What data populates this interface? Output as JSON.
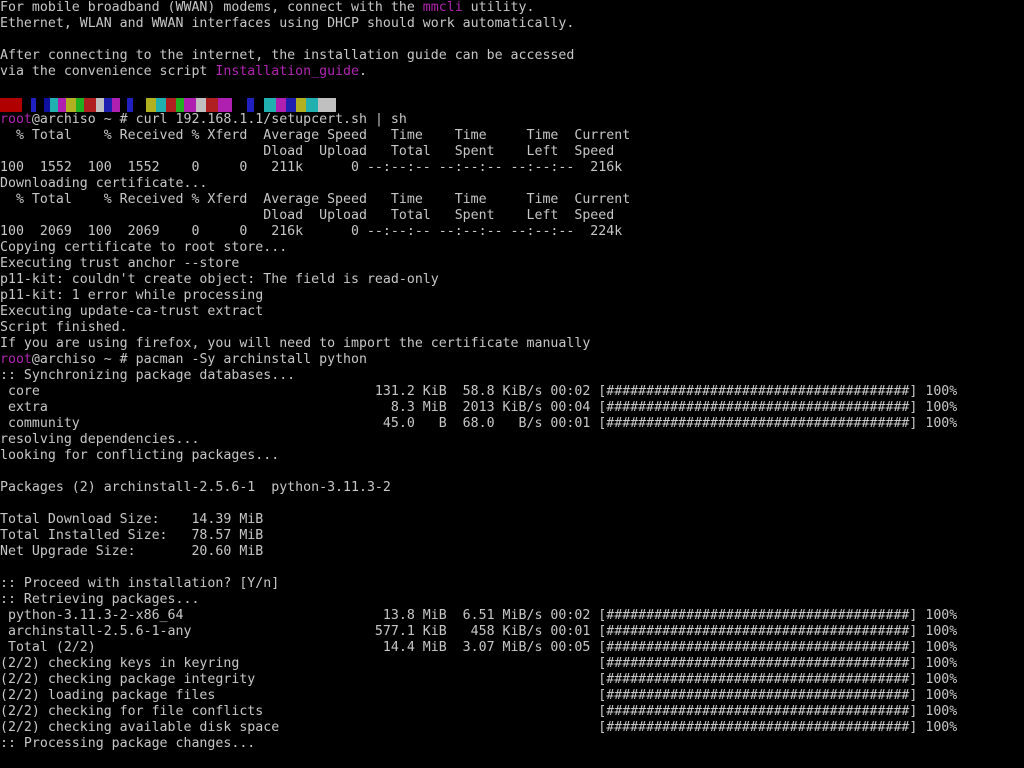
{
  "terminal": {
    "colors": {
      "background": "#000000",
      "text": "#c7c7c7",
      "accent": "#b026b0"
    },
    "intro": {
      "l1_pre": "For mobile broadband (WWAN) modems, connect with the ",
      "l1_link": "mmcli",
      "l1_post": " utility.",
      "l2": "Ethernet, WLAN and WWAN interfaces using DHCP should work automatically.",
      "l3": "After connecting to the internet, the installation guide can be accessed",
      "l4_pre": "via the convenience script ",
      "l4_link": "Installation_guide",
      "l4_post": "."
    },
    "prompt": {
      "user": "root",
      "host": "@archiso ~ # "
    },
    "cmd1": "curl 192.168.1.1/setupcert.sh | sh",
    "curl1": {
      "header1": "  % Total    % Received % Xferd  Average Speed   Time    Time     Time  Current",
      "header2": "                                 Dload  Upload   Total   Spent    Left  Speed",
      "row": "100  1552  100  1552    0     0   211k      0 --:--:-- --:--:-- --:--:--  216k"
    },
    "downloading_cert": "Downloading certificate...",
    "curl2": {
      "header1": "  % Total    % Received % Xferd  Average Speed   Time    Time     Time  Current",
      "header2": "                                 Dload  Upload   Total   Spent    Left  Speed",
      "row": "100  2069  100  2069    0     0   216k      0 --:--:-- --:--:-- --:--:--  224k"
    },
    "cert_msgs": [
      "Copying certificate to root store...",
      "Executing trust anchor --store",
      "p11-kit: couldn't create object: The field is read-only",
      "p11-kit: 1 error while processing",
      "Executing update-ca-trust extract",
      "Script finished.",
      "If you are using firefox, you will need to import the certificate manually"
    ],
    "cmd2": "pacman -Sy archinstall python",
    "sync": {
      "header": ":: Synchronizing package databases...",
      "rows": [
        " core                                          131.2 KiB  58.8 KiB/s 00:02 [######################################] 100%",
        " extra                                           8.3 MiB  2013 KiB/s 00:04 [######################################] 100%",
        " community                                      45.0   B  68.0   B/s 00:01 [######################################] 100%"
      ]
    },
    "resolving": "resolving dependencies...",
    "looking": "looking for conflicting packages...",
    "packages_line": "Packages (2) archinstall-2.5.6-1  python-3.11.3-2",
    "sizes": [
      "Total Download Size:    14.39 MiB",
      "Total Installed Size:   78.57 MiB",
      "Net Upgrade Size:       20.60 MiB"
    ],
    "proceed": ":: Proceed with installation? [Y/n]",
    "retrieving": ":: Retrieving packages...",
    "retrieve_rows": [
      " python-3.11.3-2-x86_64                         13.8 MiB  6.51 MiB/s 00:02 [######################################] 100%",
      " archinstall-2.5.6-1-any                       577.1 KiB   458 KiB/s 00:01 [######################################] 100%",
      " Total (2/2)                                    14.4 MiB  3.07 MiB/s 00:05 [######################################] 100%"
    ],
    "checks": [
      "(2/2) checking keys in keyring                                             [######################################] 100%",
      "(2/2) checking package integrity                                           [######################################] 100%",
      "(2/2) loading package files                                                [######################################] 100%",
      "(2/2) checking for file conflicts                                          [######################################] 100%",
      "(2/2) checking available disk space                                        [######################################] 100%"
    ],
    "processing": ":: Processing package changes..."
  }
}
